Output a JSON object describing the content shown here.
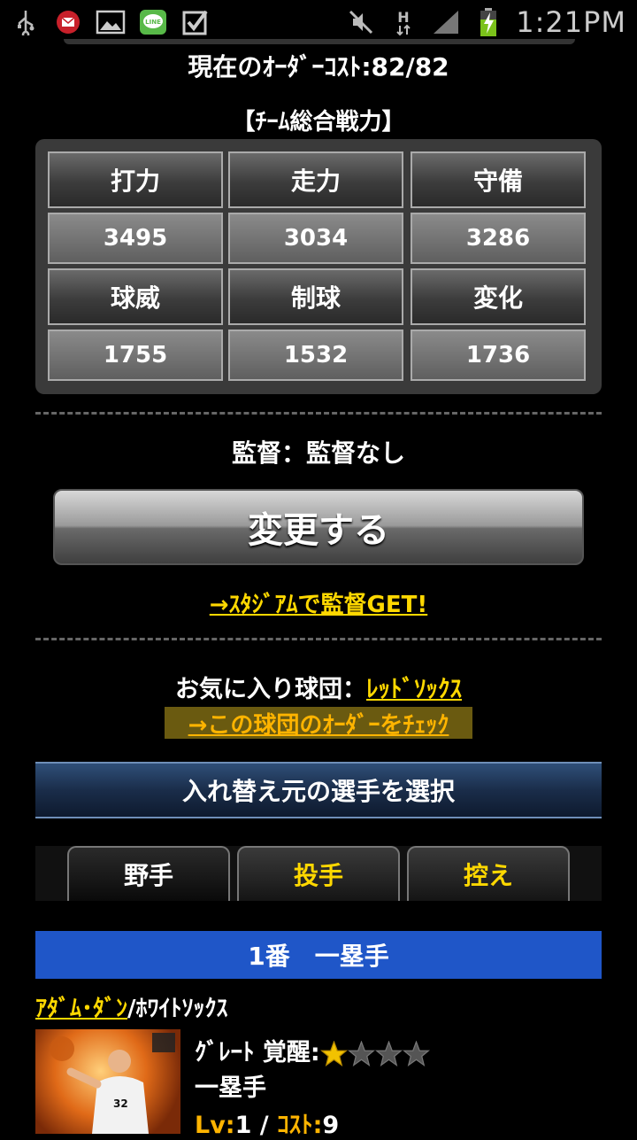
{
  "status_bar": {
    "time": "1:21PM",
    "left_icons": [
      "usb-icon",
      "mail-icon",
      "gallery-icon",
      "line-icon",
      "task-icon"
    ],
    "right_icons": [
      "mute-icon",
      "hspa-data-icon",
      "signal-icon",
      "battery-charging-icon"
    ]
  },
  "order": {
    "cost_text": "現在のｵｰﾀﾞｰｺｽﾄ:82/82"
  },
  "team_power": {
    "title": "【ﾁｰﾑ総合戦力】",
    "rows": [
      [
        "打力",
        "走力",
        "守備"
      ],
      [
        "3495",
        "3034",
        "3286"
      ],
      [
        "球威",
        "制球",
        "変化"
      ],
      [
        "1755",
        "1532",
        "1736"
      ]
    ]
  },
  "manager": {
    "text": "監督：監督なし",
    "change_button": "変更する",
    "stadium_link": "→ｽﾀｼﾞｱﾑで監督GET!"
  },
  "favorite": {
    "label": "お気に入り球団：",
    "team": "ﾚｯﾄﾞｿｯｸｽ",
    "order_link": "→この球団のｵｰﾀﾞｰをﾁｪｯｸ"
  },
  "select_banner": "入れ替え元の選手を選択",
  "tabs": [
    "野手",
    "投手",
    "控え"
  ],
  "slot": {
    "title": "1番　一塁手"
  },
  "player": {
    "name": "ｱﾀﾞﾑ･ﾀﾞﾝ",
    "team": "/ﾎﾜｲﾄｿｯｸｽ",
    "rarity_label": "ｸﾞﾚｰﾄ 覚醒:",
    "awakening_stars": 1,
    "awakening_max": 4,
    "position": "一塁手",
    "lv_label": "Lv:",
    "lv_value": "1",
    "separator": " / ",
    "cost_label": "ｺｽﾄ:",
    "cost_value": "9",
    "uniform_number": "32"
  },
  "colors": {
    "accent_yellow": "#ffd800",
    "slot_blue": "#1f56c8",
    "banner_navy": "#1a2d4a"
  }
}
